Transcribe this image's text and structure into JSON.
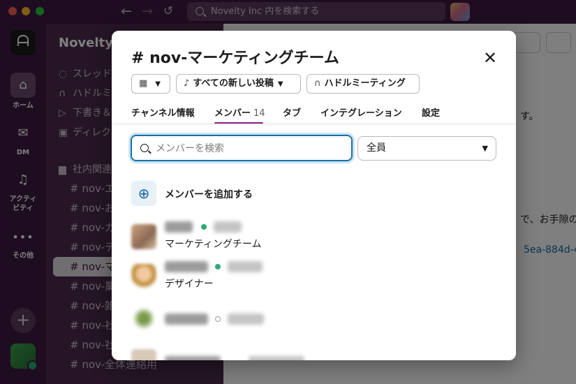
{
  "search": {
    "placeholder": "Novelty Inc 内を検索する"
  },
  "workspace": {
    "name": "Novelty Inc"
  },
  "rail": {
    "home_label": "ホーム",
    "dm_label": "DM",
    "activity_label": "アクティ\nビティ",
    "more_label": "その他"
  },
  "sidebar": {
    "items": [
      "スレッド",
      "ハドルミ",
      "下書き＆",
      "ディレク"
    ],
    "section": "社内関連",
    "channels": [
      "nov-エ",
      "nov-お",
      "nov-カ",
      "nov-デ",
      "nov-マ",
      "nov-業",
      "nov-雑",
      "nov-社",
      "nov-社",
      "nov-全体連絡用"
    ]
  },
  "main": {
    "line1": "す。",
    "line2": "で、お手隙の",
    "link": "5ea-884d-45"
  },
  "modal": {
    "title": "# nov-マーケティングチーム",
    "pills": {
      "notify": "すべての新しい投稿",
      "huddle": "ハドルミーティング"
    },
    "tabs": {
      "info": "チャンネル情報",
      "members": "メンバー",
      "members_count": "14",
      "tabs": "タブ",
      "integrations": "インテグレーション",
      "settings": "設定"
    },
    "member_search": {
      "placeholder": "メンバーを検索"
    },
    "filter": {
      "selected": "全員"
    },
    "add_member_label": "メンバーを追加する",
    "members": [
      {
        "title": "マーケティングチーム",
        "status": "active"
      },
      {
        "title": "デザイナー",
        "status": "active"
      },
      {
        "title": "",
        "status": "away"
      }
    ]
  },
  "colors": {
    "aubergine": "#3d1b40",
    "accent": "#8a2a88",
    "link": "#1264a3",
    "online": "#2bac76"
  }
}
